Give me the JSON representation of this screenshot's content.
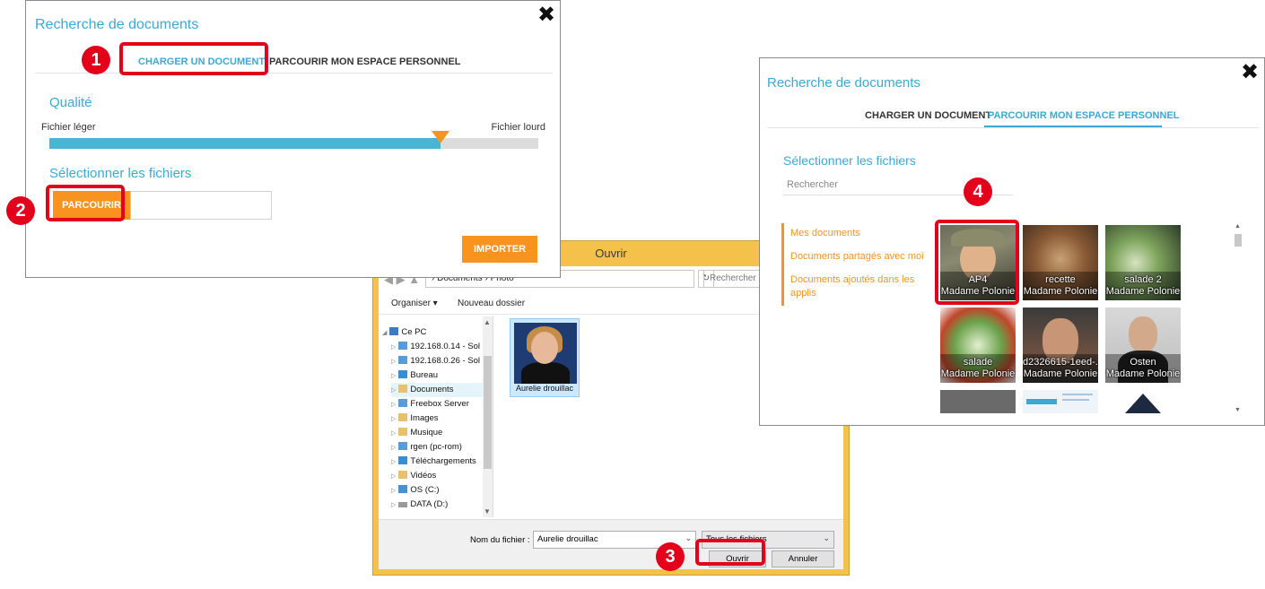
{
  "dialog1": {
    "title": "Recherche de documents",
    "close": "✖",
    "tabs": [
      "CHARGER UN DOCUMENT",
      "PARCOURIR MON ESPACE PERSONNEL"
    ],
    "quality_title": "Qualité",
    "left_label": "Fichier léger",
    "right_label": "Fichier lourd",
    "quality_level": 0.8,
    "select_title": "Sélectionner les fichiers",
    "browse_button": "PARCOURIR",
    "import_button": "IMPORTER"
  },
  "explorer": {
    "title": "Ouvrir",
    "path": "Photo",
    "path_prefix": "› Documents ›",
    "search_placeholder": "Rechercher dans...",
    "organize": "Organiser ▾",
    "new_folder": "Nouveau dossier",
    "tree": [
      "Ce PC",
      "192.168.0.14 - Sol",
      "192.168.0.26 - Sol",
      "Bureau",
      "Documents",
      "Freebox Server",
      "Images",
      "Musique",
      "rgen (pc-rom)",
      "Téléchargements",
      "Vidéos",
      "OS (C:)",
      "DATA (D:)"
    ],
    "file_name": "Aurelie drouillac",
    "filename_label": "Nom du fichier :",
    "filename_value": "Aurelie drouillac",
    "filetype_value": "Tous les fichiers",
    "open_button": "Ouvrir",
    "cancel_button": "Annuler"
  },
  "dialog2": {
    "title": "Recherche de documents",
    "close": "✖",
    "tabs": [
      "CHARGER UN DOCUMENT",
      "PARCOURIR MON ESPACE PERSONNEL"
    ],
    "select_title": "Sélectionner les fichiers",
    "search_placeholder": "Rechercher",
    "side_links": [
      "Mes documents",
      "Documents partagés avec moi",
      "Documents ajoutés dans les applis"
    ],
    "tiles": [
      {
        "name": "AP4",
        "owner": "Madame Polonie"
      },
      {
        "name": "recette",
        "owner": "Madame Polonie"
      },
      {
        "name": "salade 2",
        "owner": "Madame Polonie"
      },
      {
        "name": "salade",
        "owner": "Madame Polonie"
      },
      {
        "name": "d2326615-1eed-...",
        "owner": "Madame Polonie"
      },
      {
        "name": "Osten",
        "owner": "Madame Polonie"
      }
    ]
  },
  "annotations": [
    "1",
    "2",
    "3",
    "4"
  ],
  "colors": {
    "accent_blue": "#3aa9d5",
    "accent_orange": "#f7931e",
    "highlight_red": "#e3001b"
  }
}
